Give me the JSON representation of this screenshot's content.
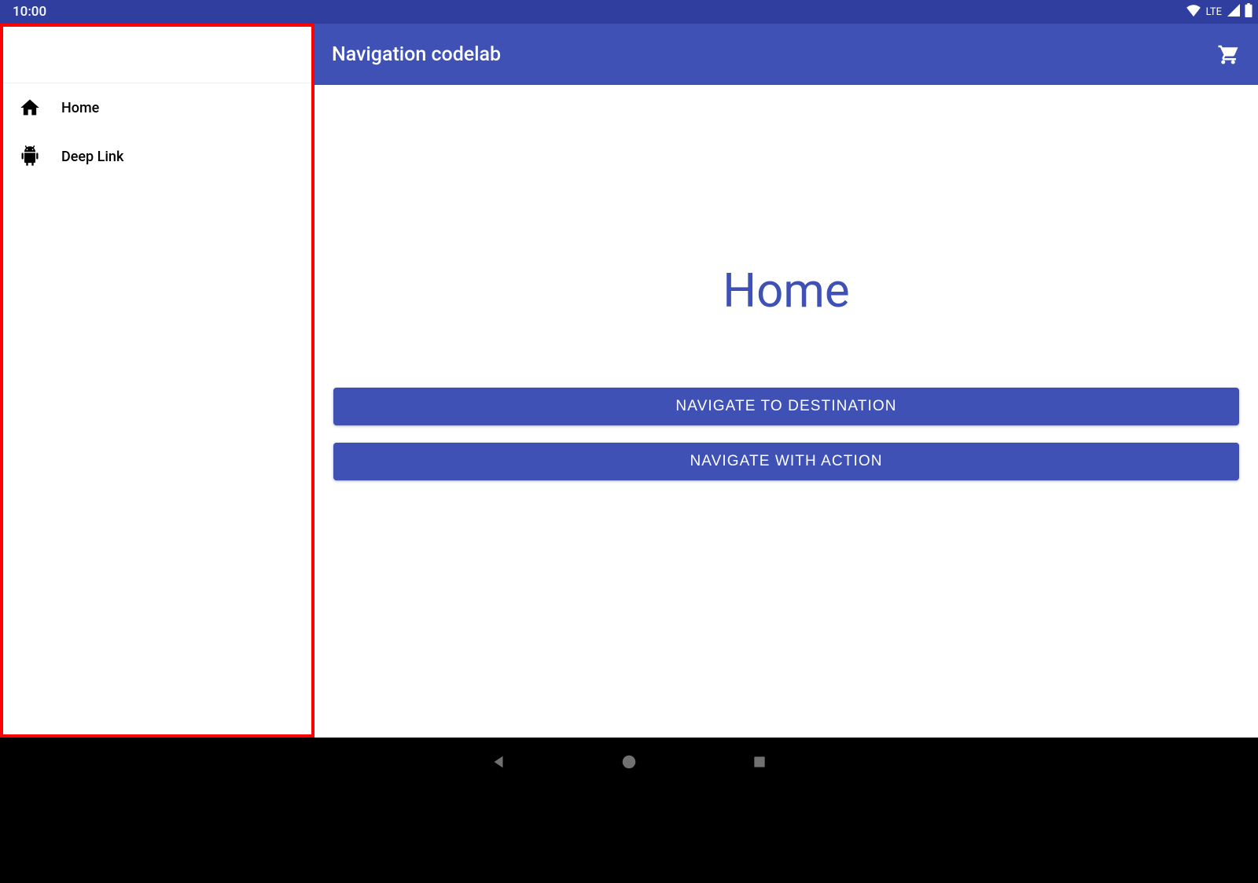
{
  "statusbar": {
    "time": "10:00",
    "network_label": "LTE"
  },
  "appbar": {
    "title": "Navigation codelab"
  },
  "drawer": {
    "items": [
      {
        "label": "Home",
        "icon": "home-icon"
      },
      {
        "label": "Deep Link",
        "icon": "android-icon"
      }
    ]
  },
  "main": {
    "title": "Home",
    "buttons": [
      {
        "label": "NAVIGATE TO DESTINATION"
      },
      {
        "label": "NAVIGATE WITH ACTION"
      }
    ]
  }
}
